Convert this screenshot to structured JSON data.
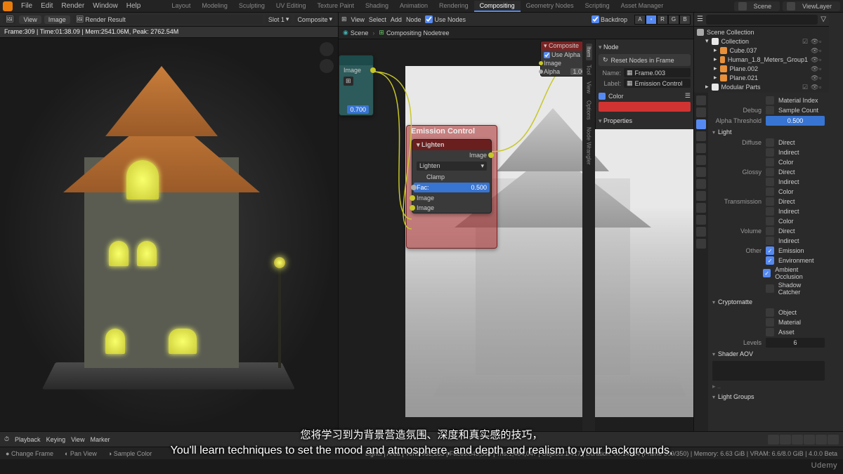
{
  "menu": {
    "file": "File",
    "edit": "Edit",
    "render": "Render",
    "window": "Window",
    "help": "Help"
  },
  "workspaces": [
    "Layout",
    "Modeling",
    "Sculpting",
    "UV Editing",
    "Texture Paint",
    "Shading",
    "Animation",
    "Rendering",
    "Compositing",
    "Geometry Nodes",
    "Scripting",
    "Asset Manager"
  ],
  "active_workspace": "Compositing",
  "scene_selector": "Scene",
  "viewlayer_selector": "ViewLayer",
  "image_editor": {
    "menu": [
      "View",
      "Image"
    ],
    "slot": "Slot 1",
    "dropdown": "Render Result",
    "mode": "Composite",
    "stats": "Frame:309 | Time:01:38.09 | Mem:2541.06M, Peak: 2762.54M"
  },
  "node_editor": {
    "menu": [
      "View",
      "Select",
      "Add",
      "Node"
    ],
    "use_nodes_label": "Use Nodes",
    "use_nodes": true,
    "backdrop_label": "Backdrop",
    "backdrop": true,
    "channels": [
      "A",
      "R",
      "G",
      "B"
    ],
    "breadcrumb": [
      {
        "icon": "scene",
        "label": "Scene"
      },
      {
        "icon": "nodetree",
        "label": "Compositing Nodetree"
      }
    ]
  },
  "composite_node": {
    "title": "Composite",
    "use_alpha": "Use Alpha",
    "use_alpha_on": true,
    "image": "Image",
    "alpha": "Alpha",
    "alpha_val": "1.00"
  },
  "npanel": {
    "node_h": "Node",
    "reset": "Reset Nodes in Frame",
    "name_l": "Name:",
    "name_v": "Frame.003",
    "label_l": "Label:",
    "label_v": "Emission Control",
    "color_h": "Color",
    "color_on": true,
    "properties_h": "Properties"
  },
  "teal_node": {
    "image": "Image",
    "val": "0.700"
  },
  "frame_label": "Emission Control",
  "mix_node": {
    "title": "Lighten",
    "mode": "Lighten",
    "image_out": "Image",
    "clamp": "Clamp",
    "fac": "Fac:",
    "fac_val": "0.500",
    "image1": "Image",
    "image2": "Image"
  },
  "outliner": {
    "scene_collection": "Scene Collection",
    "collection": "Collection",
    "items": [
      {
        "name": "Cube.037"
      },
      {
        "name": "Human_1.8_Meters_Group1"
      },
      {
        "name": "Plane.002"
      },
      {
        "name": "Plane.021"
      }
    ],
    "modular": "Modular Parts"
  },
  "props": {
    "mat_index": "Material Index",
    "debug": "Debug",
    "sample_count": "Sample Count",
    "alpha_thresh": "Alpha Threshold",
    "alpha_thresh_val": "0.500",
    "light": "Light",
    "diffuse": "Diffuse",
    "glossy": "Glossy",
    "transmission": "Transmission",
    "volume": "Volume",
    "other": "Other",
    "direct": "Direct",
    "indirect": "Indirect",
    "color": "Color",
    "emission": "Emission",
    "environment": "Environment",
    "ao": "Ambient Occlusion",
    "shadow": "Shadow Catcher",
    "crypto": "Cryptomatte",
    "object": "Object",
    "material": "Material",
    "asset": "Asset",
    "levels": "Levels",
    "levels_val": "6",
    "shader_aov": "Shader AOV",
    "light_groups": "Light Groups"
  },
  "timeline": {
    "playback": "Playback",
    "keying": "Keying",
    "view": "View",
    "marker": "Marker"
  },
  "status": {
    "change": "Change Frame",
    "pan": "Pan View",
    "sample": "Sample Color",
    "info": "Lights | Area | Verts:932,283 | Faces:843,538 | Tris:1,484,047 | Objects:1/417 | Duration: 00:14+14 (Frame 309/350) | Memory: 6.63 GiB | VRAM: 6.6/8.0 GiB | 4.0.0 Beta"
  },
  "subtitle_cn": "您将学习到为背景营造氛围、深度和真实感的技巧，",
  "subtitle_en": "You'll learn techniques to set the mood and atmosphere, and depth and realism to your backgrounds,",
  "watermark": "Udemy"
}
